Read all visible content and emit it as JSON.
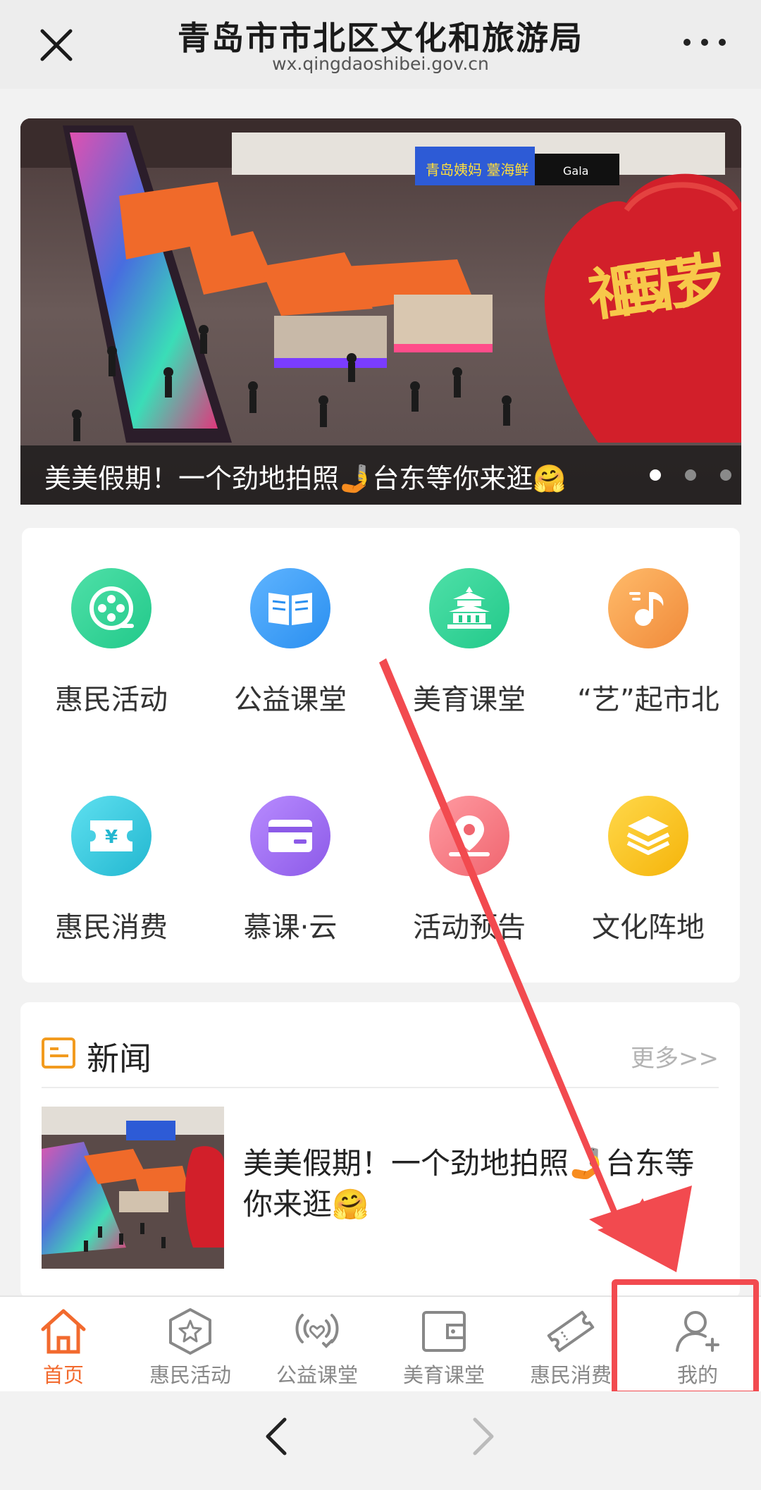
{
  "header": {
    "title": "青岛市市北区文化和旅游局",
    "url": "wx.qingdaoshibei.gov.cn"
  },
  "banner": {
    "caption": "美美假期！一个劲地拍照🤳台东等你来逛🤗",
    "slide_count": 3,
    "active_slide": 1,
    "sign_text_1": "青岛姨妈 薹海鲜",
    "sign_text_2": "Gala",
    "heart_text": "祖国万岁"
  },
  "grid": {
    "items": [
      {
        "label": "惠民活动",
        "icon": "film-reel-icon",
        "color": "#2fd49a"
      },
      {
        "label": "公益课堂",
        "icon": "open-book-icon",
        "color": "#3d9ff2"
      },
      {
        "label": "美育课堂",
        "icon": "temple-icon",
        "color": "#2fd49a"
      },
      {
        "label": "“艺”起市北",
        "icon": "music-note-icon",
        "color": "#f7a04a"
      },
      {
        "label": "惠民消费",
        "icon": "ticket-icon",
        "color": "#35c9e0"
      },
      {
        "label": "慕课·云",
        "icon": "card-icon",
        "color": "#a272f2"
      },
      {
        "label": "活动预告",
        "icon": "location-icon",
        "color": "#f57c86"
      },
      {
        "label": "文化阵地",
        "icon": "layers-icon",
        "color": "#f8c22a"
      }
    ]
  },
  "news": {
    "title": "新闻",
    "more": "更多>>",
    "items": [
      {
        "title": "美美假期！一个劲地拍照🤳台东等你来逛🤗"
      }
    ]
  },
  "tabbar": {
    "tabs": [
      {
        "label": "首页",
        "icon": "home-icon",
        "active": true
      },
      {
        "label": "惠民活动",
        "icon": "star-hexagon-icon",
        "active": false
      },
      {
        "label": "公益课堂",
        "icon": "heart-signal-icon",
        "active": false
      },
      {
        "label": "美育课堂",
        "icon": "wallet-icon",
        "active": false
      },
      {
        "label": "惠民消费",
        "icon": "ticket-icon",
        "active": false
      },
      {
        "label": "我的",
        "icon": "user-add-icon",
        "active": false
      }
    ]
  },
  "colors": {
    "accent": "#f26a2e",
    "annotation": "#f24a4f"
  }
}
